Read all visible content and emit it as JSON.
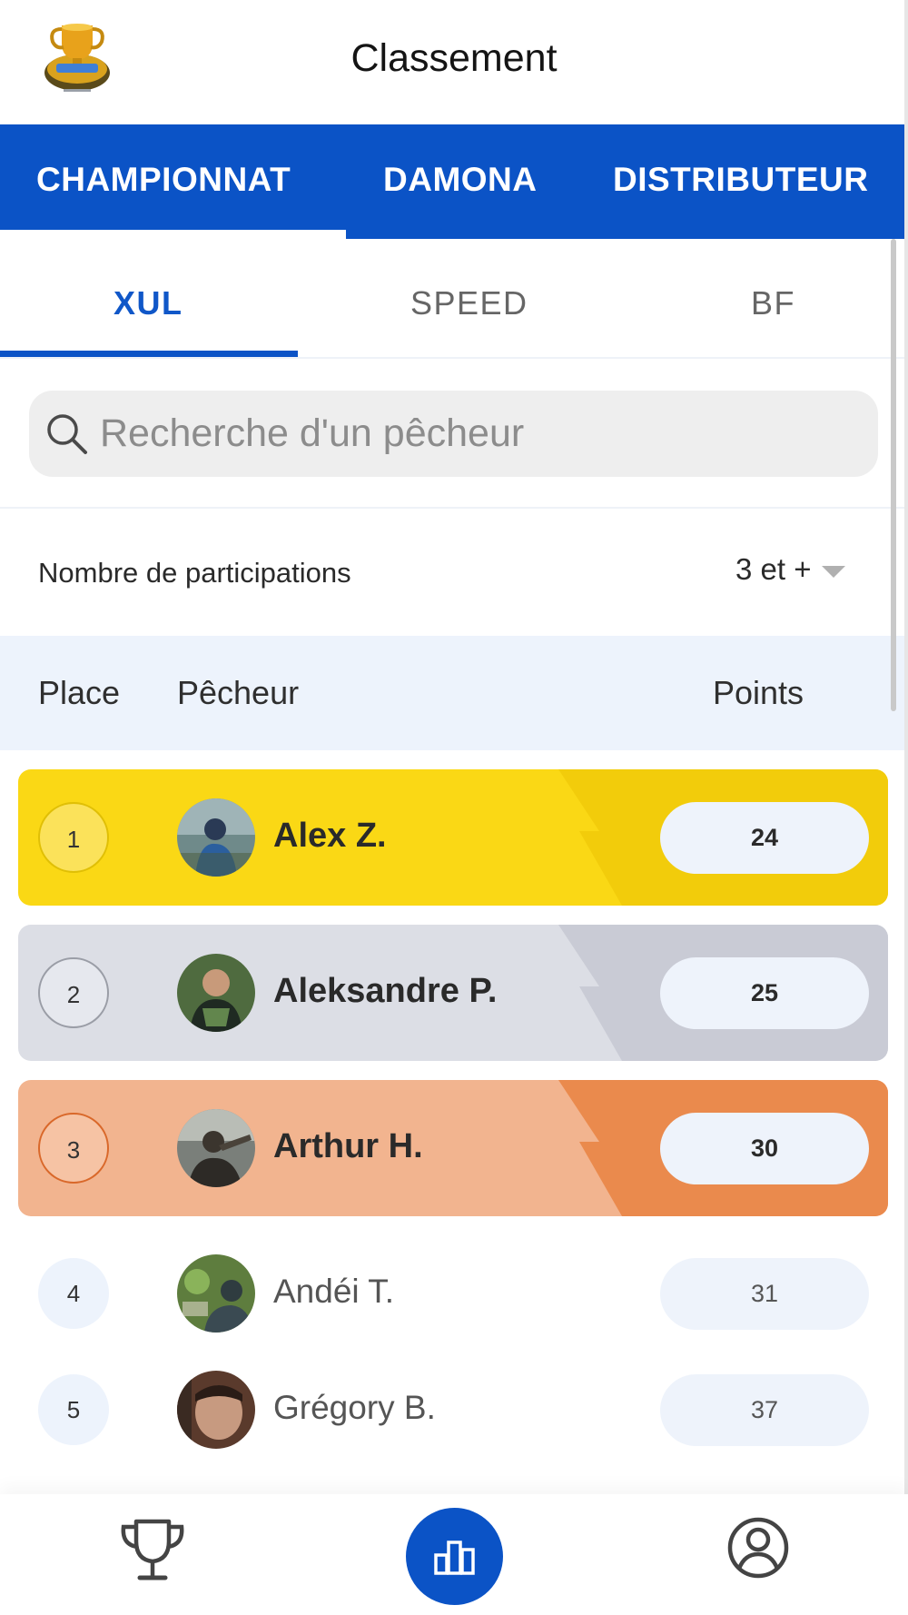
{
  "header": {
    "title": "Classement",
    "logo": "trophy-logo"
  },
  "top_tabs": [
    {
      "label": "CHAMPIONNAT",
      "active": true
    },
    {
      "label": "DAMONA",
      "active": false
    },
    {
      "label": "DISTRIBUTEUR",
      "active": false
    }
  ],
  "sub_tabs": [
    {
      "label": "XUL",
      "active": true
    },
    {
      "label": "SPEED",
      "active": false
    },
    {
      "label": "BF",
      "active": false
    }
  ],
  "search": {
    "placeholder": "Recherche d'un pêcheur",
    "value": ""
  },
  "filter": {
    "label": "Nombre de participations",
    "selected": "3 et +"
  },
  "columns": {
    "place": "Place",
    "angler": "Pêcheur",
    "points": "Points"
  },
  "rows": [
    {
      "place": "1",
      "name": "Alex Z.",
      "points": "24",
      "tier": "gold"
    },
    {
      "place": "2",
      "name": "Aleksandre P.",
      "points": "25",
      "tier": "silver"
    },
    {
      "place": "3",
      "name": "Arthur H.",
      "points": "30",
      "tier": "bronze"
    },
    {
      "place": "4",
      "name": "Andéi T.",
      "points": "31",
      "tier": "plain"
    },
    {
      "place": "5",
      "name": "Grégory B.",
      "points": "37",
      "tier": "plain"
    }
  ],
  "colors": {
    "brand_blue": "#0b53c6",
    "gold_light": "#fad815",
    "gold_dark": "#f2cc0b",
    "silver_light": "#dcdee5",
    "silver_dark": "#c9cbd5",
    "bronze_light": "#f2b48f",
    "bronze_dark": "#ea8a4d"
  },
  "bottom_nav": [
    {
      "icon": "trophy-icon",
      "active": false
    },
    {
      "icon": "leaderboard-icon",
      "active": true
    },
    {
      "icon": "profile-icon",
      "active": false
    }
  ]
}
